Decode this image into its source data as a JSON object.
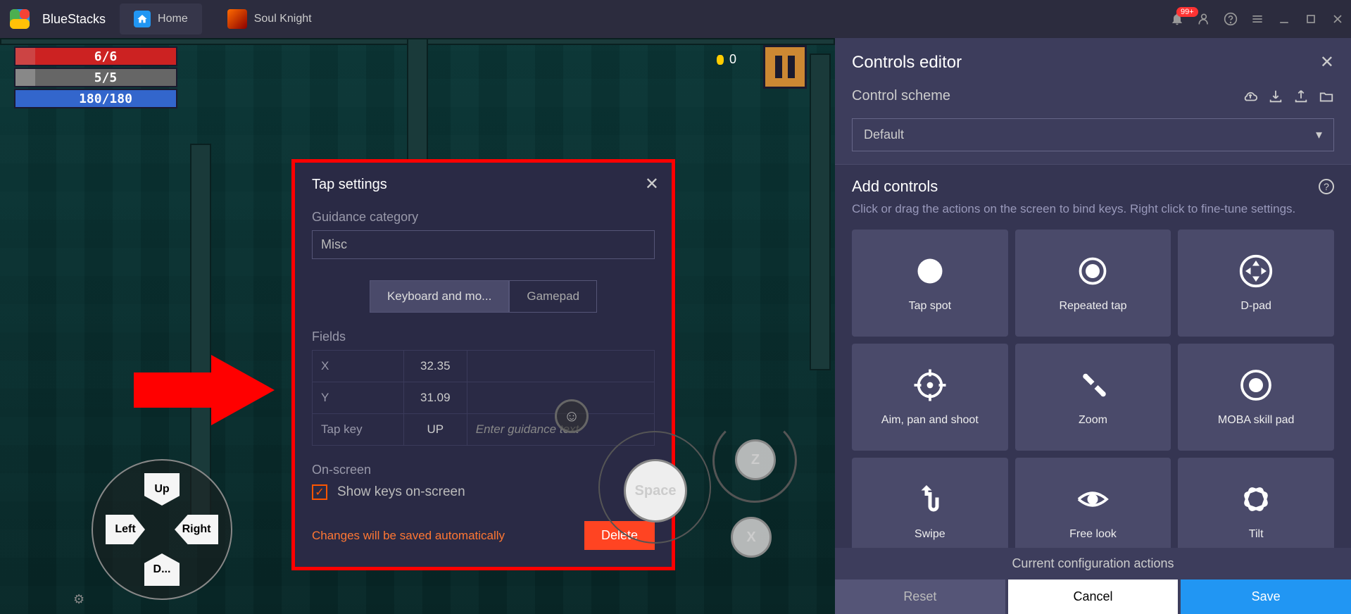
{
  "brand": "BlueStacks",
  "tabs": {
    "home": "Home",
    "game": "Soul Knight"
  },
  "notif_badge": "99+",
  "hud": {
    "hp": "6/6",
    "shield": "5/5",
    "mp": "180/180"
  },
  "coins": "0",
  "dpad": {
    "up": "Up",
    "down": "D...",
    "left": "Left",
    "right": "Right"
  },
  "overlay": {
    "space": "Space",
    "z": "Z",
    "x": "X"
  },
  "modal": {
    "title": "Tap settings",
    "guidance_label": "Guidance category",
    "guidance_value": "Misc",
    "tab_kb": "Keyboard and mo...",
    "tab_gp": "Gamepad",
    "fields_label": "Fields",
    "rows": {
      "x_label": "X",
      "x_val": "32.35",
      "y_label": "Y",
      "y_val": "31.09",
      "tap_label": "Tap key",
      "tap_val": "UP",
      "tap_placeholder": "Enter guidance text"
    },
    "onscreen_label": "On-screen",
    "show_keys": "Show keys on-screen",
    "autosave": "Changes will be saved automatically",
    "delete": "Delete"
  },
  "sidebar": {
    "title": "Controls editor",
    "scheme_label": "Control scheme",
    "scheme_value": "Default",
    "add_title": "Add controls",
    "add_hint": "Click or drag the actions on the screen to bind keys. Right click to fine-tune settings.",
    "controls": [
      "Tap spot",
      "Repeated tap",
      "D-pad",
      "Aim, pan and shoot",
      "Zoom",
      "MOBA skill pad",
      "Swipe",
      "Free look",
      "Tilt"
    ],
    "config_label": "Current configuration actions",
    "reset": "Reset",
    "cancel": "Cancel",
    "save": "Save"
  }
}
